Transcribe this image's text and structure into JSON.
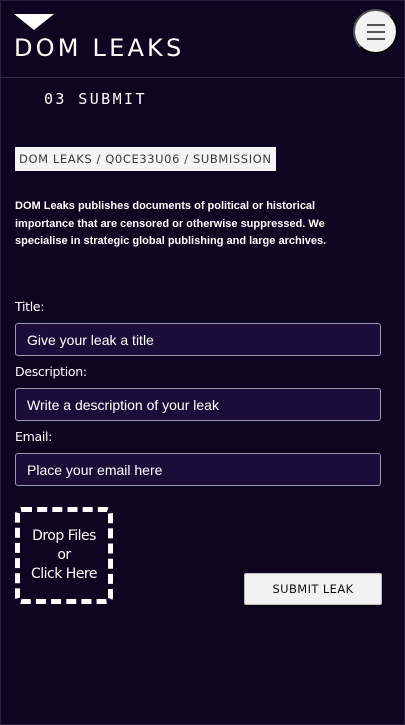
{
  "header": {
    "logo_text": "DOM LEAKS",
    "menu_icon": "hamburger-menu-icon"
  },
  "section": {
    "title": "03 SUBMIT"
  },
  "breadcrumb": "DOM LEAKS / Q0CE33U06 / SUBMISSION",
  "intro": "DOM Leaks publishes documents of political or historical importance that are censored or otherwise suppressed. We specialise in strategic global publishing and large archives.",
  "form": {
    "title_label": "Title:",
    "title_placeholder": "Give your leak a title",
    "description_label": "Description:",
    "description_placeholder": "Write a description of your leak",
    "email_label": "Email:",
    "email_placeholder": "Place your email here"
  },
  "dropzone": {
    "line1": "Drop Files",
    "line2": "or",
    "line3": "Click Here"
  },
  "submit_label": "SUBMIT LEAK",
  "colors": {
    "background": "#0e0520",
    "field_background": "#1b0d38",
    "button_background": "#f2f2f2"
  }
}
